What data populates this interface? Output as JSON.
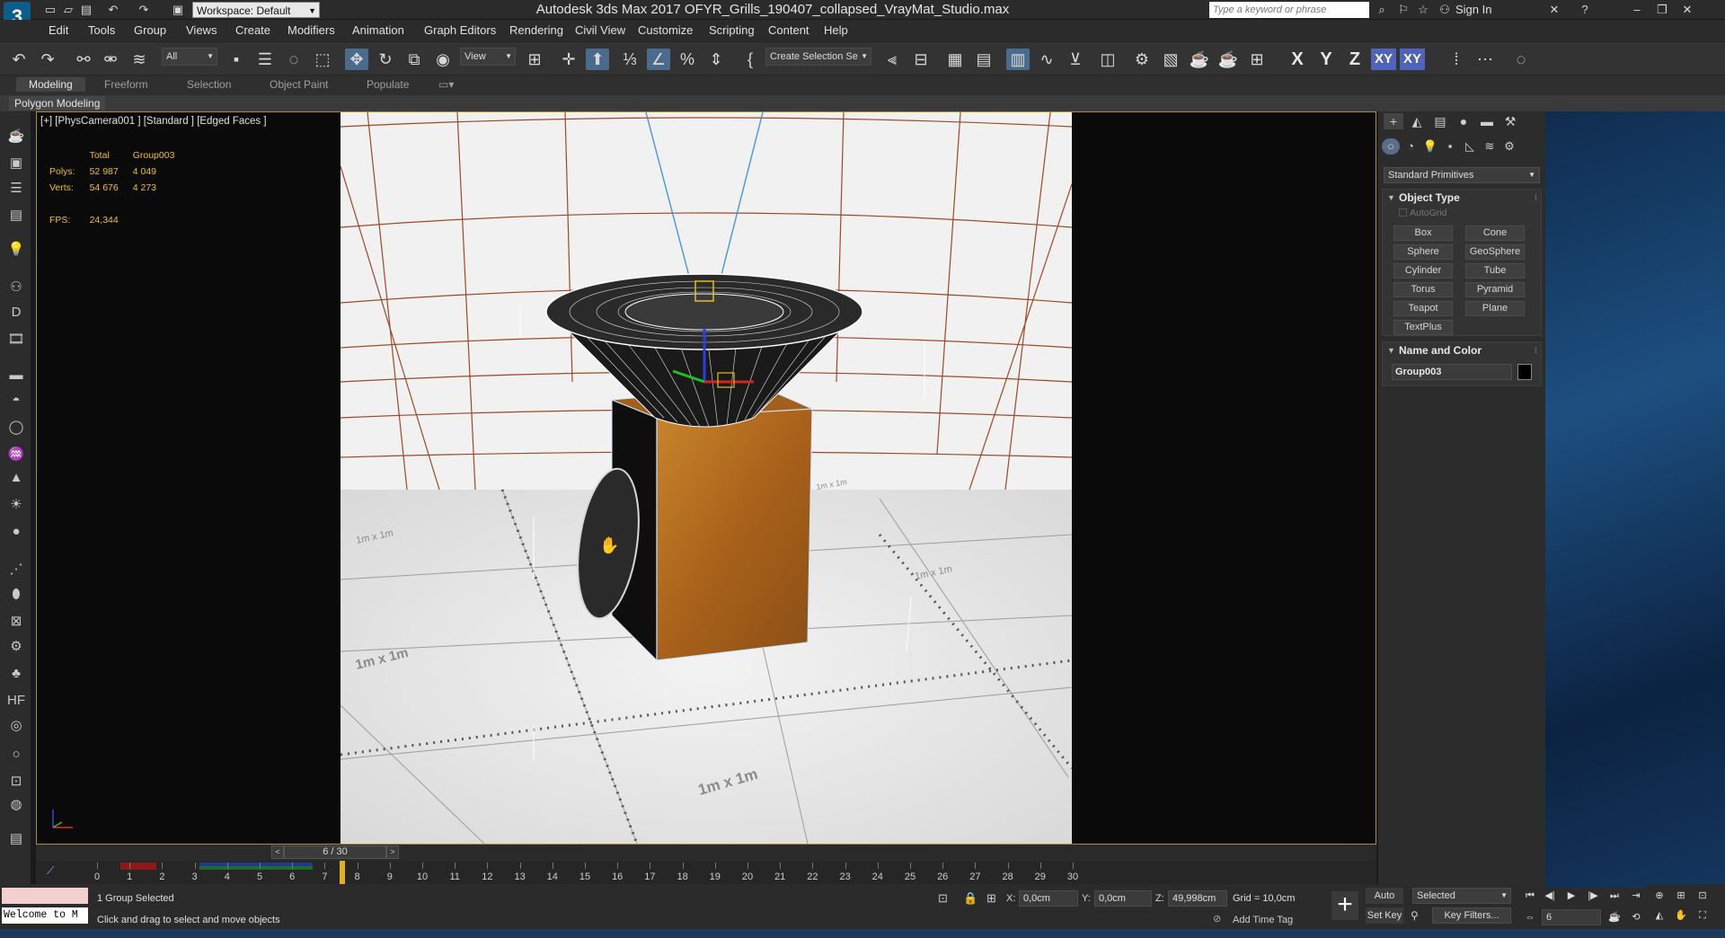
{
  "app": {
    "logo": "3",
    "title": "Autodesk 3ds Max 2017    OFYR_Grills_190407_collapsed_VrayMat_Studio.max",
    "workspace": "Workspace: Default",
    "search_placeholder": "Type a keyword or phrase",
    "sign_in": "Sign In"
  },
  "menu": [
    "Edit",
    "Tools",
    "Group",
    "Views",
    "Create",
    "Modifiers",
    "Animation",
    "Graph Editors",
    "Rendering",
    "Civil View",
    "Customize",
    "Scripting",
    "Content",
    "Help"
  ],
  "toolbar": {
    "selection_filter": "All",
    "ref_coord": "View",
    "named_selection": "Create Selection Se",
    "axis_x": "X",
    "axis_y": "Y",
    "axis_z": "Z",
    "axis_xy": "XY",
    "axis_xy2": "XY"
  },
  "ribbon": {
    "tabs": [
      "Modeling",
      "Freeform",
      "Selection",
      "Object Paint",
      "Populate"
    ],
    "active_tab": "Modeling",
    "subtab": "Polygon Modeling"
  },
  "viewport": {
    "label": "[+] [PhysCamera001 ] [Standard ] [Edged Faces ]",
    "stats": {
      "col_total": "Total",
      "col_group": "Group003",
      "polys_label": "Polys:",
      "polys_total": "52 987",
      "polys_group": "4 049",
      "verts_label": "Verts:",
      "verts_total": "54 676",
      "verts_group": "4 273",
      "fps_label": "FPS:",
      "fps_value": "24,344"
    },
    "grid_labels": [
      "1m x 1m",
      "1m x 1m",
      "1m x 1m",
      "1m x 1m",
      "1m x 1m"
    ],
    "colors": {
      "frame": "#a98f2b",
      "wall_lines": "#9a4a24",
      "wood": "#b56d1e",
      "bowl": "#1a1a1a",
      "camera_cone": "#3b8fd8"
    }
  },
  "command_panel": {
    "category": "Standard Primitives",
    "object_type_title": "Object Type",
    "autogrid": "AutoGrid",
    "primitives": [
      "Box",
      "Cone",
      "Sphere",
      "GeoSphere",
      "Cylinder",
      "Tube",
      "Torus",
      "Pyramid",
      "Teapot",
      "Plane",
      "TextPlus"
    ],
    "name_color_title": "Name and Color",
    "object_name": "Group003",
    "object_color": "#000000"
  },
  "timeline": {
    "current": "6 / 30",
    "frames": [
      "0",
      "1",
      "2",
      "3",
      "4",
      "5",
      "6",
      "7",
      "8",
      "9",
      "10",
      "11",
      "12",
      "13",
      "14",
      "15",
      "16",
      "17",
      "18",
      "19",
      "20",
      "21",
      "22",
      "23",
      "24",
      "25",
      "26",
      "27",
      "28",
      "29",
      "30"
    ]
  },
  "status": {
    "selection": "1 Group Selected",
    "prompt": "Click and drag to select and move objects",
    "maxscript": "Welcome to M",
    "x_label": "X:",
    "x_value": "0,0cm",
    "y_label": "Y:",
    "y_value": "0,0cm",
    "z_label": "Z:",
    "z_value": "49,998cm",
    "grid": "Grid = 10,0cm",
    "add_time_tag": "Add Time Tag"
  },
  "anim": {
    "auto_key": "Auto Key",
    "set_key": "Set Key",
    "key_mode": "Selected",
    "key_filters": "Key Filters...",
    "frame": "6"
  }
}
